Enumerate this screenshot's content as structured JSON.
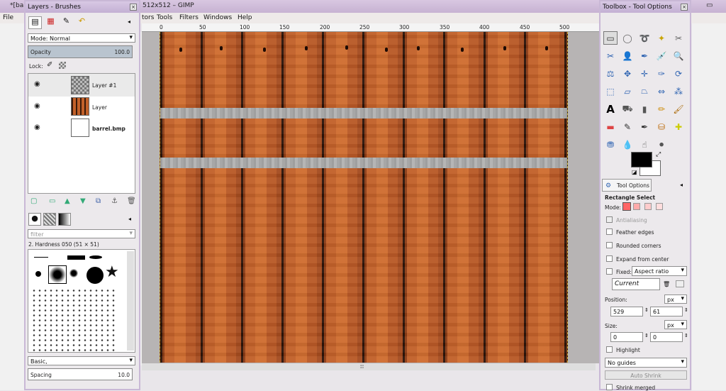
{
  "main_window": {
    "title_left": "*[ba",
    "title_mid": "512x512 – GIMP",
    "menus": [
      "File",
      "tors",
      "Tools",
      "Filters",
      "Windows",
      "Help"
    ]
  },
  "ruler_ticks": [
    "0",
    "50",
    "100",
    "150",
    "200",
    "250",
    "300",
    "350",
    "400",
    "450",
    "500"
  ],
  "layers_dock": {
    "title": "Layers - Brushes",
    "mode_label": "Mode:",
    "mode_value": "Normal",
    "opacity_label": "Opacity",
    "opacity_value": "100.0",
    "lock_label": "Lock:",
    "layers": [
      {
        "name": "Layer #1"
      },
      {
        "name": "Layer"
      },
      {
        "name": "barrel.bmp"
      }
    ],
    "filter_placeholder": "filter",
    "brush_name": "2. Hardness 050 (51 × 51)",
    "preset_label": "Basic,",
    "spacing_label": "Spacing",
    "spacing_value": "10.0"
  },
  "toolbox_dock": {
    "title": "Toolbox - Tool Options",
    "tab_label": "Tool Options",
    "tool_name": "Rectangle Select",
    "mode_label": "Mode:",
    "antialiasing": "Antialiasing",
    "feather": "Feather edges",
    "rounded": "Rounded corners",
    "expand": "Expand from center",
    "fixed_label": "Fixed:",
    "fixed_value": "Aspect ratio",
    "current_value": "Current",
    "position_label": "Position:",
    "position_unit": "px",
    "position_x": "529",
    "position_y": "61",
    "size_label": "Size:",
    "size_unit": "px",
    "size_w": "0",
    "size_h": "0",
    "highlight": "Highlight",
    "guides_value": "No guides",
    "auto_shrink": "Auto Shrink",
    "shrink_merged": "Shrink merged"
  },
  "colors": {
    "fg": "#000000",
    "bg": "#ffffff",
    "wood": "#c46328",
    "band": "#a9a9a9"
  }
}
